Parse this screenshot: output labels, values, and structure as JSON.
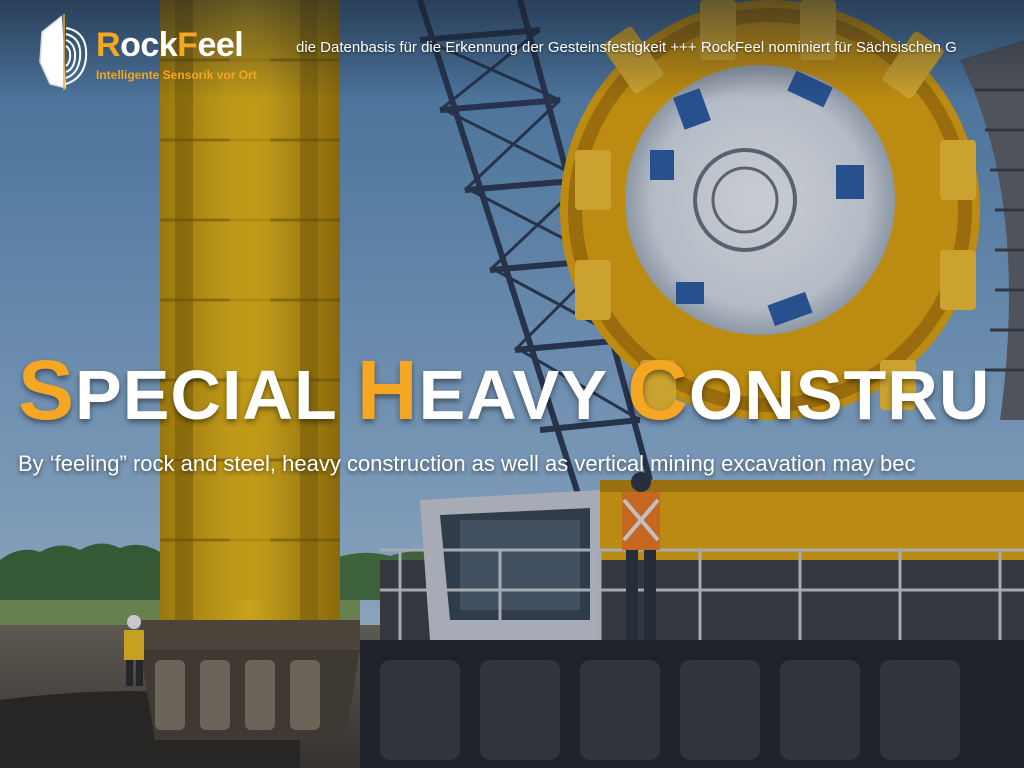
{
  "brand": {
    "name_first": "R",
    "name_part1": "ock",
    "name_f": "F",
    "name_part2": "eel",
    "tagline": "Intelligente Sensorik vor Ort",
    "logo_icon": "rock-fingerprint-icon"
  },
  "ticker": {
    "text": "die Datenbasis für die Erkennung der Gesteinsfestigkeit  +++ RockFeel nominiert für Sächsischen G"
  },
  "hero": {
    "headline": {
      "w1_first": "S",
      "w1_rest": "PECIAL ",
      "w2_first": "H",
      "w2_rest": "EAVY ",
      "w3_first": "C",
      "w3_rest": "ONSTRU"
    },
    "subline": "By ‘feeling” rock and steel, heavy construction as well as vertical mining excavation may bec"
  },
  "colors": {
    "accent": "#f5a623",
    "text": "#ffffff",
    "sky": "#6d9ac3"
  }
}
